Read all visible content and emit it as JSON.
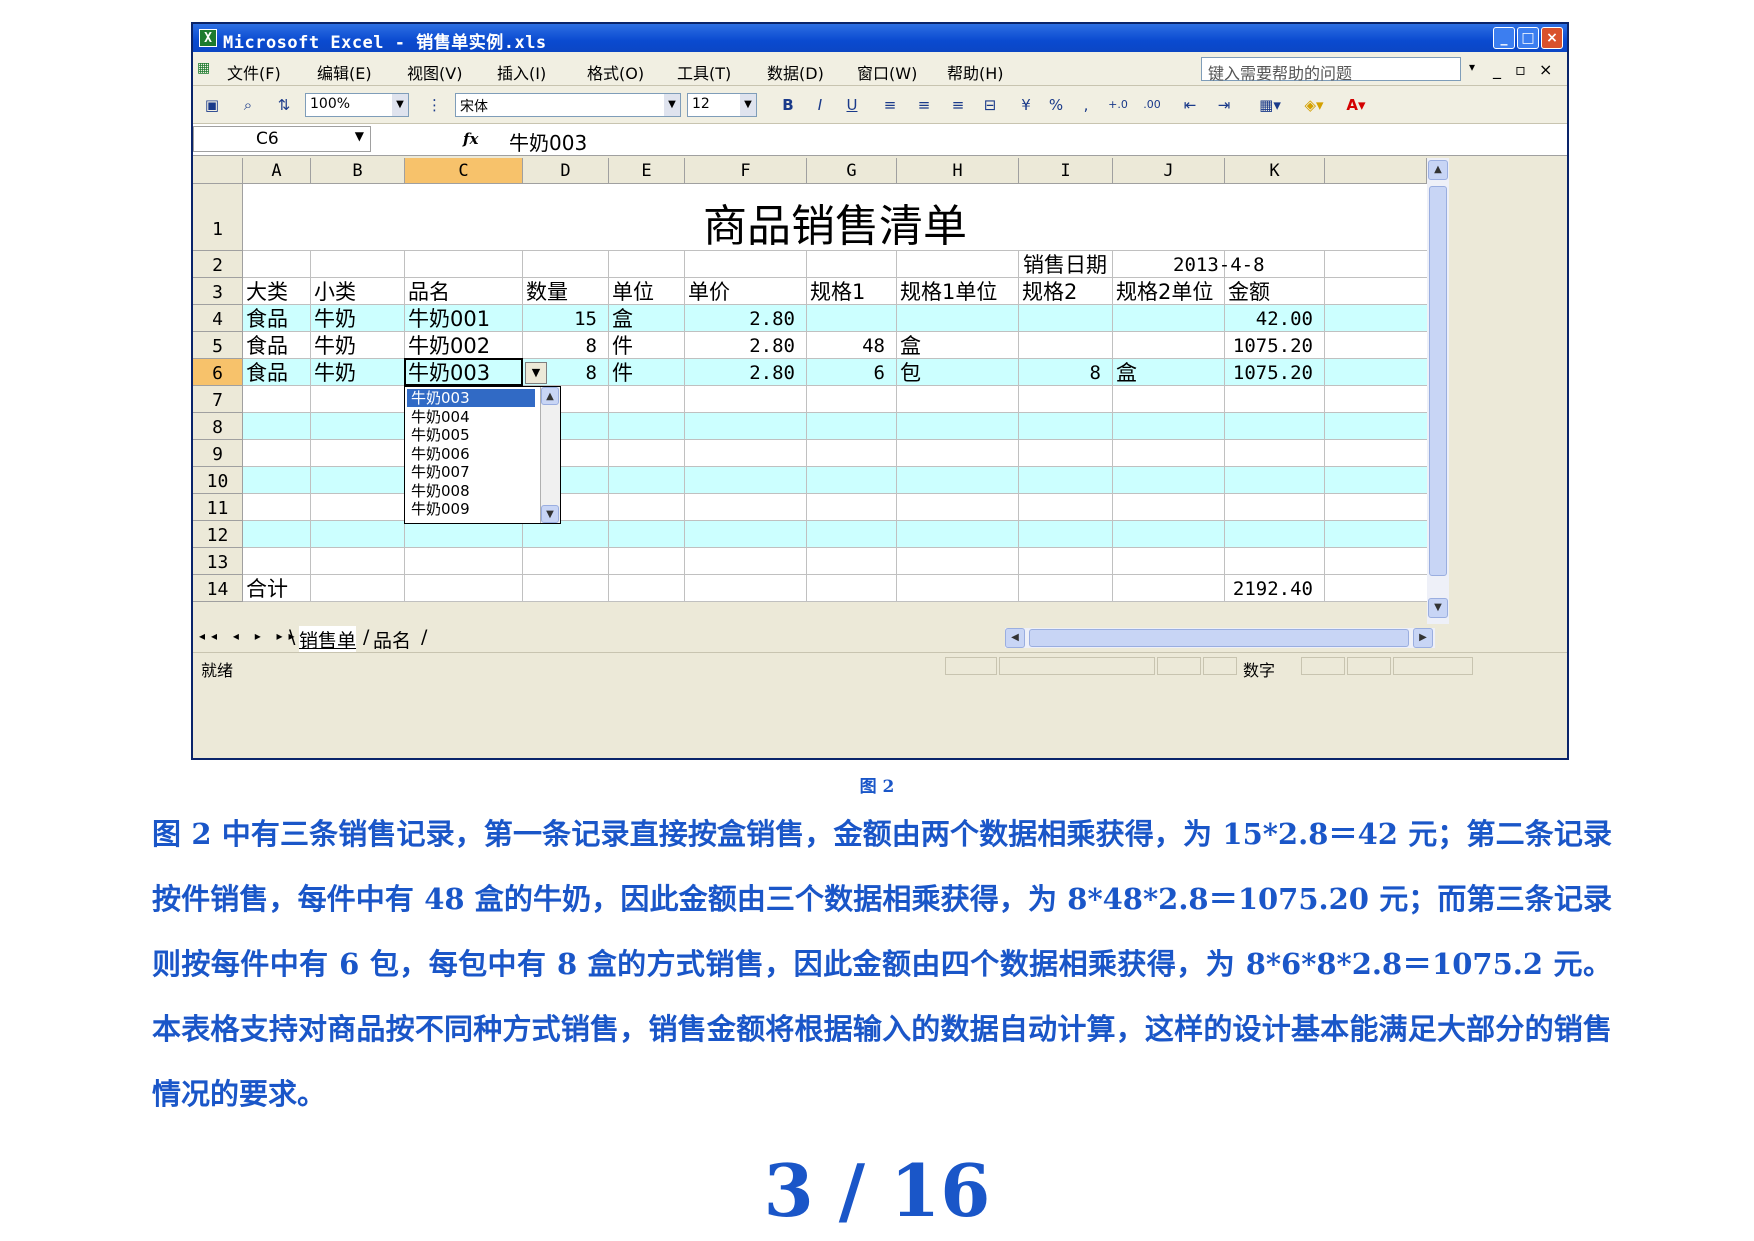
{
  "window": {
    "title": "Microsoft Excel - 销售单实例.xls",
    "app_icon": "excel-icon",
    "caption_buttons": [
      "_",
      "□",
      "×"
    ]
  },
  "menu": {
    "items": [
      "文件(F)",
      "编辑(E)",
      "视图(V)",
      "插入(I)",
      "格式(O)",
      "工具(T)",
      "数据(D)",
      "窗口(W)",
      "帮助(H)"
    ],
    "help_placeholder": "键入需要帮助的问题"
  },
  "toolbar": {
    "zoom": "100%",
    "font_name": "宋体",
    "font_size": "12",
    "bold": "B",
    "italic": "I",
    "underline": "U",
    "percent": "%",
    "comma": ","
  },
  "formula_bar": {
    "name_box": "C6",
    "fx": "fx",
    "formula": "牛奶003"
  },
  "sheet": {
    "columns": [
      "A",
      "B",
      "C",
      "D",
      "E",
      "F",
      "G",
      "H",
      "I",
      "J",
      "K"
    ],
    "selected_column": "C",
    "rows": [
      "1",
      "2",
      "3",
      "4",
      "5",
      "6",
      "7",
      "8",
      "9",
      "10",
      "11",
      "12",
      "13",
      "14"
    ],
    "selected_row": "6",
    "title": "商品销售清单",
    "sale_date_label": "销售日期",
    "sale_date": "2013-4-8",
    "headers": [
      "大类",
      "小类",
      "品名",
      "数量",
      "单位",
      "单价",
      "规格1",
      "规格1单位",
      "规格2",
      "规格2单位",
      "金额"
    ],
    "records": [
      [
        "食品",
        "牛奶",
        "牛奶001",
        "15",
        "盒",
        "2.80",
        "",
        "",
        "",
        "",
        "42.00"
      ],
      [
        "食品",
        "牛奶",
        "牛奶002",
        "8",
        "件",
        "2.80",
        "48",
        "盒",
        "",
        "",
        "1075.20"
      ],
      [
        "食品",
        "牛奶",
        "牛奶003",
        "8",
        "件",
        "2.80",
        "6",
        "包",
        "8",
        "盒",
        "1075.20"
      ]
    ],
    "total_label": "合计",
    "total_value": "2192.40",
    "band_color": "#ccffff"
  },
  "dropdown": {
    "options": [
      "牛奶003",
      "牛奶004",
      "牛奶005",
      "牛奶006",
      "牛奶007",
      "牛奶008",
      "牛奶009"
    ],
    "highlighted": "牛奶003"
  },
  "tabs": {
    "nav": "◂◂ ◂ ▸ ▸▸",
    "items": [
      "销售单",
      "品名"
    ],
    "active": "销售单"
  },
  "status": {
    "ready": "就绪",
    "mode": "数字"
  },
  "document": {
    "caption": "图 2",
    "paragraph": "图 2 中有三条销售记录，第一条记录直接按盒销售，金额由两个数据相乘获得，为 15*2.8＝42 元；第二条记录按件销售，每件中有 48 盒的牛奶，因此金额由三个数据相乘获得，为 8*48*2.8＝1075.20 元；而第三条记录则按每件中有 6 包，每包中有 8 盒的方式销售，因此金额由四个数据相乘获得，为 8*6*8*2.8＝1075.2 元。本表格支持对商品按不同种方式销售，销售金额将根据输入的数据自动计算，这样的设计基本能满足大部分的销售情况的要求。",
    "page_number": "3 / 16"
  },
  "colors": {
    "accent": "#1a56c8",
    "titlebar": "#0a4ad0",
    "selection": "#f7c26b",
    "highlight": "#316ac5"
  }
}
